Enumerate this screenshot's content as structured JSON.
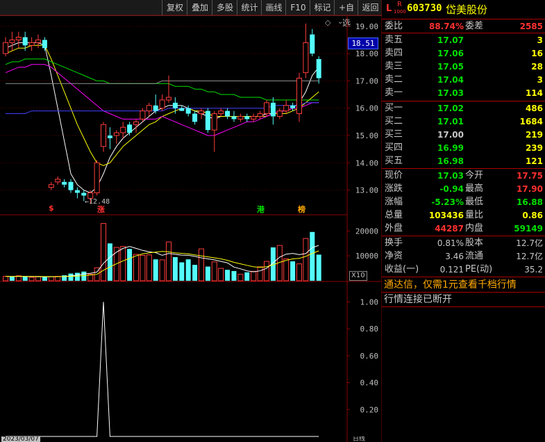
{
  "toolbar": {
    "items": [
      "复权",
      "叠加",
      "多股",
      "统计",
      "画线",
      "F10",
      "标记",
      "+自选",
      "返回"
    ]
  },
  "stock": {
    "market_mark": "L",
    "r_mark": "R",
    "r_sub": "1000",
    "code": "603730",
    "name": "岱美股份"
  },
  "quote": {
    "weibi_label": "委比",
    "weibi_value": "88.74%",
    "weicha_label": "委差",
    "weicha_value": "2585",
    "sell": [
      {
        "label": "卖五",
        "price": "17.07",
        "vol": "3"
      },
      {
        "label": "卖四",
        "price": "17.06",
        "vol": "16"
      },
      {
        "label": "卖三",
        "price": "17.05",
        "vol": "28"
      },
      {
        "label": "卖二",
        "price": "17.04",
        "vol": "3"
      },
      {
        "label": "卖一",
        "price": "17.03",
        "vol": "114"
      }
    ],
    "buy": [
      {
        "label": "买一",
        "price": "17.02",
        "vol": "486"
      },
      {
        "label": "买二",
        "price": "17.01",
        "vol": "1684"
      },
      {
        "label": "买三",
        "price": "17.00",
        "vol": "219"
      },
      {
        "label": "买四",
        "price": "16.99",
        "vol": "239"
      },
      {
        "label": "买五",
        "price": "16.98",
        "vol": "121"
      }
    ],
    "stats": [
      {
        "l1": "现价",
        "v1": "17.03",
        "c1": "#00e000",
        "l2": "今开",
        "v2": "17.75",
        "c2": "#ff3030"
      },
      {
        "l1": "涨跌",
        "v1": "-0.94",
        "c1": "#00e000",
        "l2": "最高",
        "v2": "17.90",
        "c2": "#ff3030"
      },
      {
        "l1": "涨幅",
        "v1": "-5.23%",
        "c1": "#00e000",
        "l2": "最低",
        "v2": "16.88",
        "c2": "#00e000"
      },
      {
        "l1": "总量",
        "v1": "103436",
        "c1": "#ffff00",
        "l2": "量比",
        "v2": "0.86",
        "c2": "#ffff00"
      },
      {
        "l1": "外盘",
        "v1": "44287",
        "c1": "#ff3030",
        "l2": "内盘",
        "v2": "59149",
        "c2": "#00e000"
      }
    ],
    "fund": [
      {
        "l1": "换手",
        "v1": "0.81%",
        "l2": "股本",
        "v2": "12.7亿"
      },
      {
        "l1": "净资",
        "v1": "3.46",
        "l2": "流通",
        "v2": "12.7亿"
      },
      {
        "l1": "收益(一)",
        "v1": "0.121",
        "l2": "PE(动)",
        "v2": "35.2"
      }
    ],
    "notice": "通达信，仅需1元查看千档行情",
    "notice_highlight": "1",
    "status": "行情连接已断开"
  },
  "chart_labels": {
    "current_price": "18.51",
    "low_annotation": "12.48",
    "vol_unit": "X10",
    "markers": [
      {
        "text": "$",
        "color": "#ff3030"
      },
      {
        "text": "涨",
        "color": "#ff3030"
      },
      {
        "text": "港",
        "color": "#00e000"
      },
      {
        "text": "榜",
        "color": "#ffaa00"
      }
    ],
    "bottom_date": "2023/03/07",
    "bottom_right": "日线"
  },
  "chart_data": [
    {
      "type": "candlestick",
      "ylim": [
        12.2,
        19.3
      ],
      "yticks": [
        "19.00",
        "18.00",
        "17.00",
        "16.00",
        "15.00",
        "14.00",
        "13.00"
      ],
      "candles": [
        [
          18.0,
          18.6,
          17.9,
          18.4
        ],
        [
          18.4,
          18.8,
          18.1,
          18.5
        ],
        [
          18.5,
          18.8,
          18.2,
          18.6
        ],
        [
          18.6,
          18.8,
          18.1,
          18.3
        ],
        [
          18.3,
          18.6,
          18.1,
          18.4
        ],
        [
          18.4,
          18.7,
          18.2,
          18.5
        ],
        [
          18.5,
          18.6,
          18.1,
          18.2
        ],
        [
          13.1,
          13.3,
          13.0,
          13.2
        ],
        [
          13.3,
          13.5,
          13.2,
          13.4
        ],
        [
          13.3,
          13.4,
          13.1,
          13.2
        ],
        [
          13.3,
          13.4,
          12.9,
          13.0
        ],
        [
          13.0,
          13.1,
          12.7,
          12.9
        ],
        [
          12.9,
          13.0,
          12.6,
          12.8
        ],
        [
          12.7,
          13.0,
          12.5,
          12.9
        ],
        [
          12.9,
          14.1,
          12.8,
          14.0
        ],
        [
          14.6,
          15.5,
          14.4,
          15.4
        ],
        [
          15.0,
          15.3,
          14.5,
          14.9
        ],
        [
          15.0,
          15.2,
          14.7,
          15.1
        ],
        [
          15.1,
          15.5,
          14.9,
          15.3
        ],
        [
          15.4,
          15.5,
          15.0,
          15.1
        ],
        [
          15.4,
          15.6,
          15.1,
          15.5
        ],
        [
          15.6,
          16.0,
          15.5,
          15.9
        ],
        [
          15.9,
          16.2,
          15.7,
          16.1
        ],
        [
          16.1,
          16.5,
          15.8,
          15.9
        ],
        [
          16.0,
          16.5,
          15.9,
          16.3
        ],
        [
          16.3,
          17.2,
          16.2,
          16.4
        ],
        [
          16.2,
          16.4,
          15.8,
          16.0
        ],
        [
          16.0,
          16.1,
          15.9,
          15.9
        ],
        [
          16.0,
          16.1,
          15.7,
          15.8
        ],
        [
          15.8,
          15.9,
          15.4,
          15.5
        ],
        [
          15.8,
          16.0,
          15.6,
          15.9
        ],
        [
          15.9,
          16.0,
          15.1,
          15.2
        ],
        [
          15.2,
          15.9,
          14.4,
          15.8
        ],
        [
          15.8,
          16.0,
          15.7,
          15.9
        ],
        [
          15.9,
          16.0,
          15.6,
          15.7
        ],
        [
          15.7,
          15.9,
          15.5,
          15.6
        ],
        [
          15.6,
          15.8,
          15.5,
          15.7
        ],
        [
          15.7,
          15.8,
          15.5,
          15.6
        ],
        [
          15.6,
          15.8,
          15.5,
          15.7
        ],
        [
          15.7,
          15.9,
          15.6,
          15.8
        ],
        [
          15.8,
          16.3,
          15.7,
          16.2
        ],
        [
          16.2,
          16.4,
          15.4,
          15.7
        ],
        [
          15.7,
          16.0,
          15.6,
          15.9
        ],
        [
          15.9,
          16.3,
          15.8,
          16.1
        ],
        [
          16.1,
          16.2,
          15.9,
          16.0
        ],
        [
          15.8,
          17.3,
          15.5,
          17.1
        ],
        [
          17.3,
          19.1,
          17.1,
          18.4
        ],
        [
          18.7,
          18.9,
          17.9,
          18.0
        ],
        [
          17.8,
          17.9,
          16.9,
          17.1
        ]
      ],
      "ma": [
        {
          "color": "#ffffff",
          "values": [
            18.2,
            18.3,
            18.4,
            18.4,
            18.4,
            18.4,
            18.3,
            17.2,
            16.0,
            14.8,
            13.6,
            13.2,
            13.0,
            12.9,
            13.1,
            13.6,
            14.2,
            14.6,
            14.9,
            15.1,
            15.3,
            15.5,
            15.7,
            15.9,
            16.0,
            16.1,
            16.1,
            16.1,
            16.0,
            15.9,
            15.8,
            15.7,
            15.6,
            15.7,
            15.7,
            15.7,
            15.7,
            15.7,
            15.7,
            15.7,
            15.8,
            15.8,
            15.9,
            15.9,
            16.0,
            16.2,
            16.6,
            17.2,
            17.5
          ]
        },
        {
          "color": "#ffff00",
          "values": [
            18.0,
            18.1,
            18.2,
            18.2,
            18.3,
            18.3,
            18.3,
            17.8,
            17.2,
            16.6,
            16.0,
            15.4,
            14.9,
            14.4,
            14.0,
            13.9,
            14.0,
            14.3,
            14.6,
            14.8,
            15.0,
            15.2,
            15.4,
            15.5,
            15.7,
            15.8,
            15.9,
            16.0,
            16.0,
            15.9,
            15.9,
            15.8,
            15.7,
            15.7,
            15.7,
            15.7,
            15.7,
            15.7,
            15.7,
            15.7,
            15.7,
            15.8,
            15.8,
            15.8,
            15.9,
            16.0,
            16.2,
            16.4,
            16.6
          ]
        },
        {
          "color": "#ff00ff",
          "values": [
            17.3,
            17.4,
            17.5,
            17.5,
            17.6,
            17.6,
            17.6,
            17.5,
            17.3,
            17.1,
            16.9,
            16.7,
            16.5,
            16.3,
            16.1,
            15.9,
            15.8,
            15.7,
            15.6,
            15.6,
            15.6,
            15.6,
            15.6,
            15.6,
            15.7,
            15.6,
            15.5,
            15.4,
            15.3,
            15.2,
            15.1,
            15.0,
            15.0,
            15.1,
            15.2,
            15.3,
            15.4,
            15.5,
            15.5,
            15.6,
            15.7,
            15.8,
            15.9,
            15.9,
            16.0,
            16.0,
            16.1,
            16.2,
            16.2
          ]
        },
        {
          "color": "#00e000",
          "values": [
            17.6,
            17.7,
            17.7,
            17.8,
            17.8,
            17.8,
            17.8,
            17.7,
            17.6,
            17.5,
            17.4,
            17.3,
            17.2,
            17.1,
            17.0,
            17.0,
            16.9,
            16.9,
            16.9,
            16.9,
            16.9,
            16.9,
            16.9,
            16.9,
            16.9,
            16.9,
            16.8,
            16.8,
            16.8,
            16.7,
            16.7,
            16.6,
            16.6,
            16.5,
            16.5,
            16.5,
            16.4,
            16.4,
            16.4,
            16.4,
            16.3,
            16.3,
            16.3,
            16.3,
            16.3,
            16.3,
            16.3,
            16.3,
            16.3
          ]
        },
        {
          "color": "#909090",
          "values": [
            16.9,
            16.9,
            16.9,
            16.9,
            16.9,
            16.9,
            16.9,
            16.9,
            16.9,
            16.9,
            16.9,
            16.9,
            16.9,
            16.9,
            16.9,
            16.9,
            16.9,
            16.9,
            16.9,
            16.9,
            16.9,
            16.9,
            16.9,
            16.9,
            17.0,
            17.0,
            17.0,
            17.0,
            17.0,
            17.0,
            17.0,
            17.0,
            17.0,
            17.0,
            17.0,
            17.0,
            17.0,
            17.0,
            17.0,
            17.0,
            17.0,
            17.0,
            17.0,
            17.0,
            17.0,
            17.0,
            17.0,
            17.0,
            17.0
          ]
        },
        {
          "color": "#4040ff",
          "values": [
            15.8,
            15.8,
            15.8,
            15.8,
            15.9,
            15.9,
            15.9,
            15.9,
            15.9,
            15.9,
            15.9,
            15.9,
            15.9,
            15.9,
            15.9,
            15.9,
            15.9,
            15.9,
            15.9,
            15.9,
            15.9,
            15.9,
            15.9,
            15.9,
            15.9,
            16.0,
            16.0,
            16.0,
            16.0,
            16.0,
            16.0,
            16.0,
            16.0,
            16.0,
            16.0,
            16.0,
            16.0,
            16.0,
            16.0,
            16.0,
            16.0,
            16.1,
            16.1,
            16.1,
            16.1,
            16.1,
            16.2,
            16.2,
            16.2
          ]
        }
      ]
    },
    {
      "type": "bar",
      "ylim": [
        0,
        24000
      ],
      "yticks": [
        "20000",
        "10000"
      ],
      "values": [
        1800,
        1600,
        2000,
        1700,
        1400,
        1600,
        1500,
        1700,
        1800,
        2200,
        2900,
        3200,
        3700,
        2600,
        5200,
        23000,
        15000,
        13400,
        13800,
        12800,
        10600,
        10200,
        10400,
        8600,
        8400,
        15600,
        9500,
        7400,
        8600,
        6400,
        12800,
        5700,
        7600,
        5000,
        4400,
        3900,
        2600,
        3400,
        3800,
        5600,
        7800,
        13400,
        14200,
        8800,
        7800,
        6800,
        17000,
        19600,
        10500
      ],
      "up": [
        1,
        0,
        1,
        0,
        1,
        1,
        0,
        1,
        1,
        0,
        0,
        0,
        0,
        1,
        1,
        1,
        0,
        1,
        1,
        0,
        1,
        1,
        1,
        0,
        1,
        1,
        0,
        0,
        0,
        0,
        1,
        0,
        1,
        1,
        0,
        0,
        1,
        0,
        1,
        1,
        1,
        0,
        1,
        1,
        0,
        1,
        1,
        0,
        0
      ],
      "ma": [
        {
          "color": "#ffffff",
          "values": [
            1800,
            1700,
            1800,
            1750,
            1700,
            1650,
            1600,
            1600,
            1650,
            1750,
            1950,
            2300,
            2800,
            3000,
            3500,
            7000,
            9500,
            11500,
            13000,
            13800,
            13000,
            12200,
            11600,
            11300,
            10200,
            11000,
            10600,
            10300,
            10200,
            9800,
            9200,
            8800,
            8400,
            7800,
            7200,
            5500,
            4800,
            4000,
            3600,
            4000,
            5000,
            7200,
            9500,
            10700,
            11000,
            10500,
            10900,
            13300,
            14200
          ]
        },
        {
          "color": "#ffff00",
          "values": [
            1800,
            1750,
            1780,
            1770,
            1750,
            1720,
            1700,
            1680,
            1680,
            1700,
            1780,
            1900,
            2100,
            2300,
            2600,
            4200,
            5600,
            6800,
            8000,
            9000,
            10000,
            10800,
            11200,
            11500,
            11800,
            11600,
            11200,
            11000,
            10800,
            10400,
            10000,
            9600,
            9200,
            8800,
            8200,
            7400,
            6800,
            6200,
            5600,
            5400,
            5600,
            6400,
            7400,
            8200,
            8800,
            9000,
            9800,
            11000,
            12000
          ]
        }
      ]
    },
    {
      "type": "line",
      "ylim": [
        0,
        1.1
      ],
      "yticks": [
        "1.00",
        "0.80",
        "0.60",
        "0.40",
        "0.20"
      ],
      "values": [
        0,
        0,
        0,
        0,
        0,
        0,
        0,
        0,
        0,
        0,
        0,
        0,
        0,
        0,
        0,
        1,
        0,
        0,
        0,
        0,
        0,
        0,
        0,
        0,
        0,
        0,
        0,
        0,
        0,
        0,
        0,
        0,
        0,
        0,
        0,
        0,
        0,
        0,
        0,
        0,
        0,
        0,
        0,
        0,
        0,
        0,
        0,
        0,
        0
      ]
    }
  ]
}
